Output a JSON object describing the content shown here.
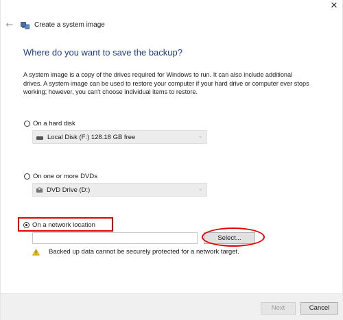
{
  "window": {
    "title": "Create a system image",
    "close_glyph": "✕",
    "back_glyph": "←"
  },
  "main": {
    "heading": "Where do you want to save the backup?",
    "description": "A system image is a copy of the drives required for Windows to run. It can also include additional drives. A system image can be used to restore your computer if your hard drive or computer ever stops working; however, you can't choose individual items to restore."
  },
  "options": {
    "hard_disk": {
      "label": "On a hard disk",
      "selected": false,
      "dropdown_value": "Local Disk (F:)  128.18 GB free"
    },
    "dvd": {
      "label": "On one or more DVDs",
      "selected": false,
      "dropdown_value": "DVD Drive (D:)"
    },
    "network": {
      "label": "On a network location",
      "selected": true,
      "path_value": "",
      "select_button": "Select...",
      "warning": "Backed up data cannot be securely protected for a network target."
    }
  },
  "footer": {
    "next_label": "Next",
    "cancel_label": "Cancel"
  },
  "icons": {
    "app": "backup-app-icon",
    "drive": "hard-drive-icon",
    "dvd": "dvd-drive-icon",
    "warning": "warning-icon",
    "dropdown": "chevron-down-icon"
  },
  "colors": {
    "heading": "#1f3c88",
    "annotation": "#e30000",
    "warning": "#f5c400"
  }
}
